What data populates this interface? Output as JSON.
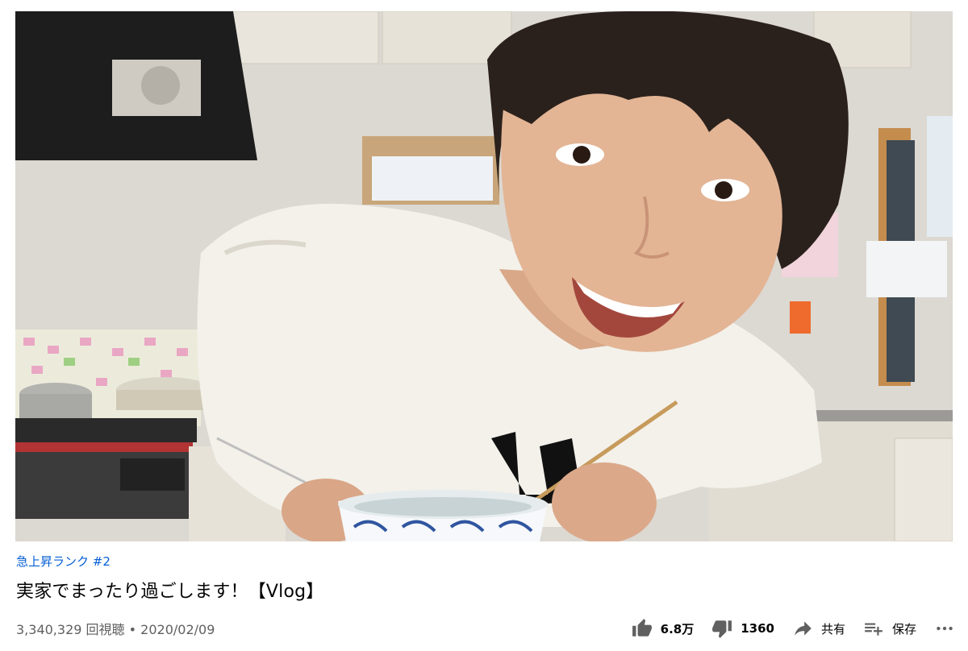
{
  "player": {
    "thumbnail_icon": "video-frame"
  },
  "meta": {
    "hashtag": "急上昇ランク #2",
    "title": "実家でまったり過ごします！【Vlog】",
    "views": "3,340,329 回視聴",
    "separator": "•",
    "date": "2020/02/09"
  },
  "actions": {
    "like": {
      "icon": "thumbs-up-icon",
      "count": "6.8万"
    },
    "dislike": {
      "icon": "thumbs-down-icon",
      "count": "1360"
    },
    "share": {
      "icon": "share-icon",
      "label": "共有"
    },
    "save": {
      "icon": "playlist-add-icon",
      "label": "保存"
    },
    "more": {
      "icon": "more-icon"
    }
  },
  "colors": {
    "link": "#065fd4",
    "text": "#030303",
    "secondary": "#606060",
    "background": "#ffffff"
  }
}
